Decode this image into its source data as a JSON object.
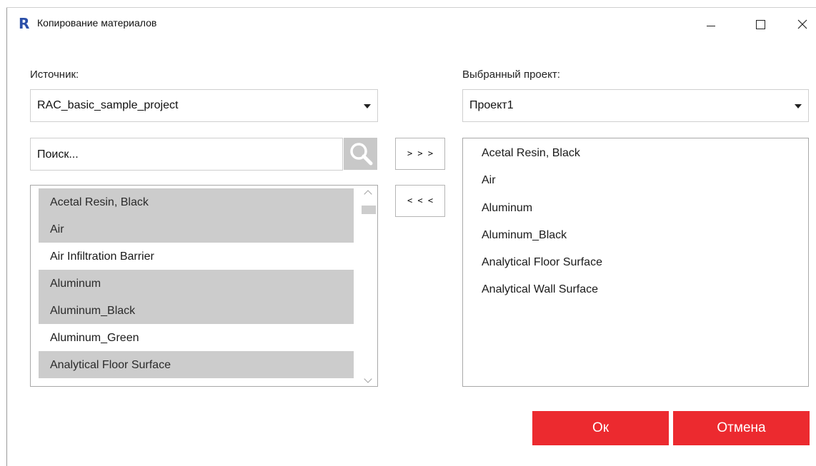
{
  "window": {
    "title": "Копирование материалов",
    "app_icon_letter": "R",
    "controls": {
      "minimize": "minimize-icon",
      "maximize": "maximize-icon",
      "close": "close-icon"
    }
  },
  "source": {
    "label": "Источник:",
    "selected": "RAC_basic_sample_project",
    "search_placeholder": "Поиск...",
    "items": [
      {
        "label": "Acetal Resin, Black",
        "selected": true
      },
      {
        "label": "Air",
        "selected": true
      },
      {
        "label": "Air Infiltration Barrier",
        "selected": false
      },
      {
        "label": "Aluminum",
        "selected": true
      },
      {
        "label": "Aluminum_Black",
        "selected": true
      },
      {
        "label": "Aluminum_Green",
        "selected": false
      },
      {
        "label": "Analytical Floor Surface",
        "selected": true
      }
    ]
  },
  "target": {
    "label": "Выбранный проект:",
    "selected": "Проект1",
    "items": [
      "Acetal Resin, Black",
      "Air",
      "Aluminum",
      "Aluminum_Black",
      "Analytical Floor Surface",
      "Analytical Wall Surface"
    ]
  },
  "transfer": {
    "add_label": "> > >",
    "remove_label": "< < <"
  },
  "actions": {
    "ok_label": "Ок",
    "cancel_label": "Отмена"
  },
  "colors": {
    "accent": "#ec2a2f",
    "selection": "#cccccc"
  }
}
